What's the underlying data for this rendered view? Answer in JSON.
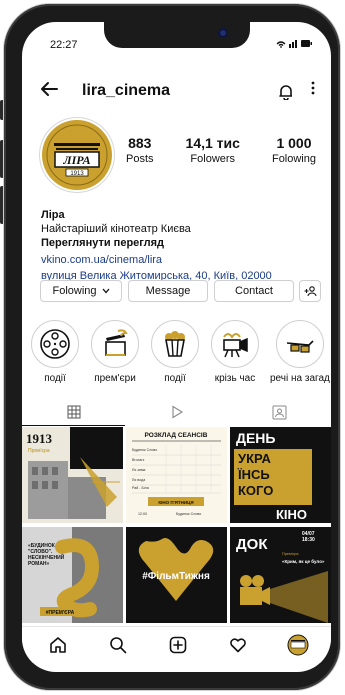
{
  "status": {
    "time": "22:27",
    "icons": "wifi-icon signal-icon battery-icon"
  },
  "appbar": {
    "username": "lira_cinema"
  },
  "profile": {
    "logo_text": "ЛІРА",
    "logo_year": "1913",
    "stats": [
      {
        "num": "883",
        "label": "Posts"
      },
      {
        "num": "14,1 тис",
        "label": "Folowers"
      },
      {
        "num": "1 000",
        "label": "Folowing"
      }
    ],
    "bio": {
      "name": "Ліра",
      "desc": "Найстаріший кінотеатр Києва",
      "view": "Переглянути перегляд",
      "link": "vkino.com.ua/cinema/lira",
      "address": "вулиця Велика Житомирська, 40, Київ, 02000"
    },
    "buttons": {
      "following": "Folowing",
      "message": "Message",
      "contact": "Contact"
    }
  },
  "highlights": [
    {
      "label": "події",
      "icon": "film-reel-icon"
    },
    {
      "label": "прем'єри",
      "icon": "clapperboard-icon"
    },
    {
      "label": "події",
      "icon": "popcorn-icon"
    },
    {
      "label": "крізь час",
      "icon": "film-camera-icon"
    },
    {
      "label": "речі на загад",
      "icon": "3d-glasses-icon"
    }
  ],
  "posts": {
    "p1": {
      "year": "1913",
      "sub": "Прем'єра"
    },
    "p2": {
      "title": "РОЗКЛАД СЕАНСІВ",
      "rows": [
        "Будинок Слово",
        "Brocarz",
        "Ля зима",
        "Ля вода",
        "Рай - Біла"
      ],
      "footer": "КІНО П'ЯТНИЦЯ",
      "note1": "12:00",
      "note2": "Будинок Слово"
    },
    "p3": {
      "l1": "ДЕНЬ",
      "l2": "УКРА",
      "l3": "ЇНСЬ",
      "l4": "КОГО",
      "l5": "КІНО"
    },
    "p4": {
      "quote": "«БУДИНОК \"СЛОВО\". НЕСКІНЧЕНИЙ РОМАН»",
      "tag": "#ПРЕМ'ЄРА"
    },
    "p5": {
      "hashtag": "#ФільмТижня"
    },
    "p6": {
      "title": "ДОК",
      "date": "04/07",
      "time": "18:30",
      "sub": "«Крим, як це було»",
      "small": "Прем'єра"
    }
  },
  "colors": {
    "gold": "#caa12e",
    "dark": "#1b1b1b",
    "accent_blue": "#1b3c86"
  }
}
